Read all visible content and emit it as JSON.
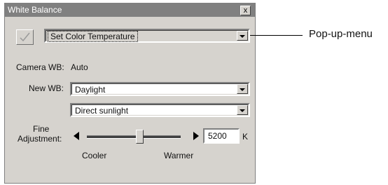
{
  "window": {
    "title": "White Balance",
    "close_glyph": "x"
  },
  "set_button": {
    "icon": "checkmark-icon"
  },
  "mode_select": {
    "value": "Set Color Temperature"
  },
  "camera_wb": {
    "label": "Camera WB:",
    "value": "Auto"
  },
  "new_wb": {
    "label": "New WB:",
    "value": "Daylight"
  },
  "sub_select": {
    "value": "Direct sunlight"
  },
  "fine": {
    "label_line1": "Fine",
    "label_line2": "Adjustment:",
    "cooler": "Cooler",
    "warmer": "Warmer",
    "value": "5200",
    "unit": "K"
  },
  "callout": {
    "text": "Pop-up-menu"
  },
  "colors": {
    "panel": "#d6d3ce",
    "titlebar": "#808080"
  }
}
